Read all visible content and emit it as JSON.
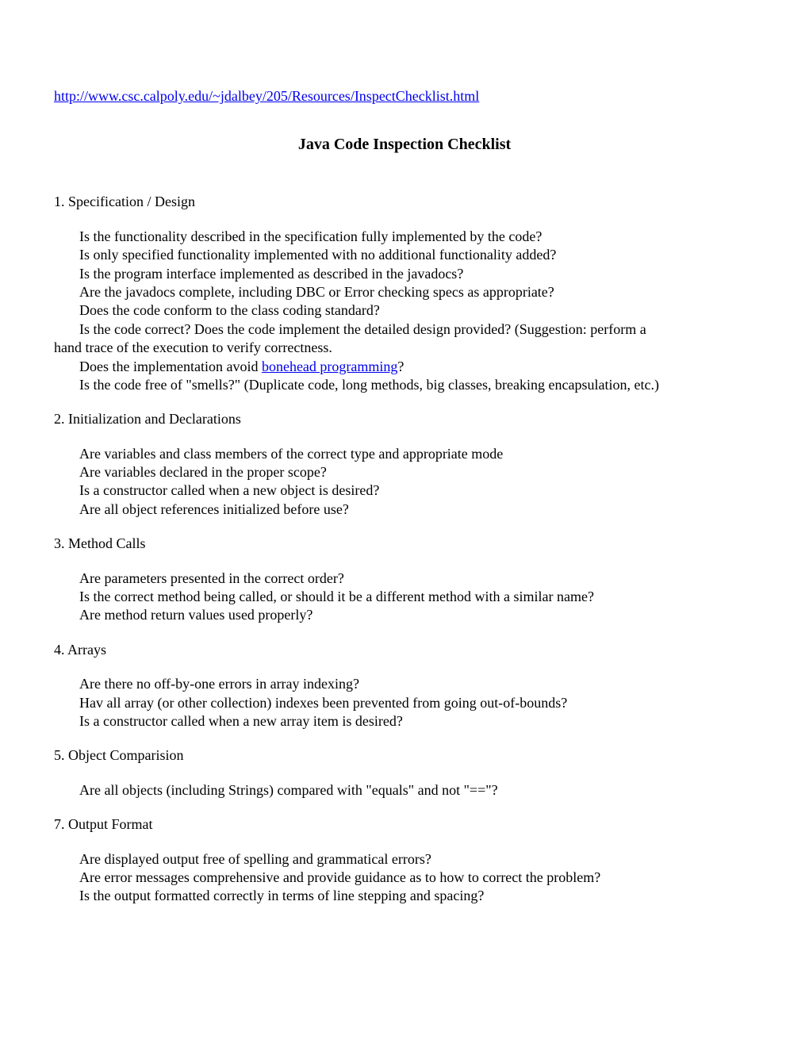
{
  "source_link": "http://www.csc.calpoly.edu/~jdalbey/205/Resources/InspectChecklist.html",
  "title": "Java Code Inspection Checklist",
  "sections": [
    {
      "heading": "1. Specification / Design",
      "items": [
        {
          "text": "Is the functionality described in the specification fully implemented by the code?"
        },
        {
          "text": "Is only specified functionality implemented with no additional functionality added?"
        },
        {
          "text": "Is the program interface implemented as described in the javadocs?"
        },
        {
          "text": "Are the javadocs complete, including DBC or Error checking specs as appropriate?"
        },
        {
          "text": "Does the code conform to the class coding standard?"
        },
        {
          "text": "Is the code correct? Does the code implement the detailed design provided? (Suggestion: perform a",
          "hanging_continuation": "hand trace of the execution to verify correctness."
        },
        {
          "text_before_link": "Does the implementation avoid ",
          "link_text": "bonehead programming",
          "text_after_link": "?"
        },
        {
          "text": "Is the code free of \"smells?\" (Duplicate code, long methods, big classes, breaking encapsulation, etc.)"
        }
      ]
    },
    {
      "heading": "2. Initialization and Declarations",
      "items": [
        {
          "text": "Are variables and class members of the correct type and appropriate mode"
        },
        {
          "text": "Are variables declared in the proper scope?"
        },
        {
          "text": "Is a constructor called when a new object is desired?"
        },
        {
          "text": "Are all object references initialized before use?"
        }
      ]
    },
    {
      "heading": "3. Method Calls",
      "items": [
        {
          "text": "Are parameters presented in the correct order?"
        },
        {
          "text": "Is the correct method being called, or should it be a different method with a similar name?"
        },
        {
          "text": "Are method return values used properly?"
        }
      ]
    },
    {
      "heading": "4. Arrays",
      "items": [
        {
          "text": "Are there no off-by-one errors in array indexing?"
        },
        {
          "text": "Hav all array (or other collection) indexes been prevented from going out-of-bounds?"
        },
        {
          "text": "Is a constructor called when a new array item is desired?"
        }
      ]
    },
    {
      "heading": "5. Object Comparision",
      "items": [
        {
          "text": "Are all objects (including Strings)  compared with \"equals\" and not \"==\"?"
        }
      ]
    },
    {
      "heading": "7. Output Format",
      "items": [
        {
          "text": "Are displayed output free of spelling and grammatical errors?"
        },
        {
          "text": "Are error messages comprehensive and provide guidance as to how to correct the problem?"
        },
        {
          "text": "Is the output formatted correctly in terms of line stepping and spacing?"
        }
      ]
    }
  ]
}
